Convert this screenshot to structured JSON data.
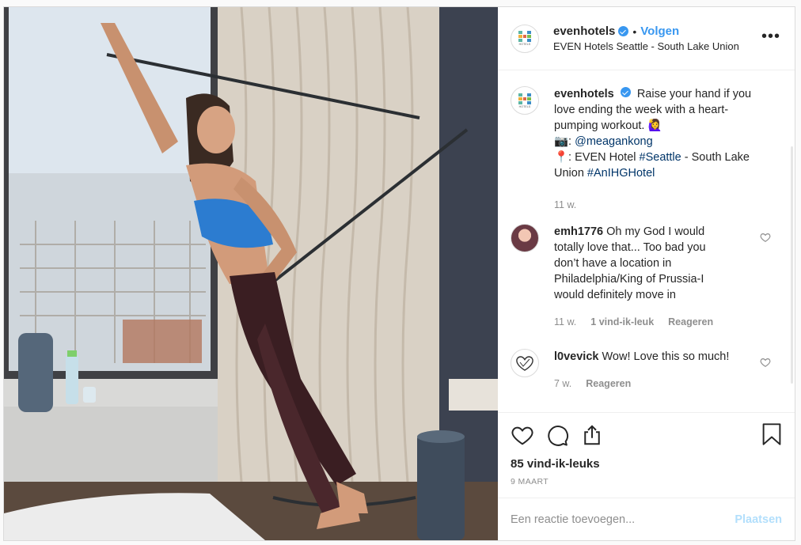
{
  "post_header": {
    "username": "evenhotels",
    "separator": "•",
    "follow_label": "Volgen",
    "location": "EVEN Hotels Seattle - South Lake Union",
    "more_label": "•••"
  },
  "logo_text": "HOTELS",
  "caption": {
    "username": "evenhotels",
    "text_1": "Raise your hand if you love ending the week with a heart-pumping workout. 🙋‍♀️",
    "camera_prefix": "📷: ",
    "mention": "@meagankong",
    "pin_prefix": "📍: EVEN Hotel ",
    "hashtag_1": "#Seattle",
    "text_2": " - South Lake Union ",
    "hashtag_2": "#AnIHGHotel",
    "time": "11 w."
  },
  "comments": [
    {
      "username": "emh1776",
      "text": "Oh my God I would totally love that... Too bad you don’t have a location in Philadelphia/King of Prussia-I would definitely move in",
      "time": "11 w.",
      "likes": "1 vind-ik-leuk",
      "reply": "Reageren"
    },
    {
      "username": "l0vevick",
      "text": "Wow! Love this so much!",
      "time": "7 w.",
      "reply": "Reageren"
    }
  ],
  "engagement": {
    "likes": "85 vind-ik-leuks",
    "date": "9 MAART"
  },
  "add_comment": {
    "placeholder": "Een reactie toevoegen...",
    "post_label": "Plaatsen"
  },
  "colors": {
    "accent": "#3897f0",
    "link": "#003569",
    "muted": "#8e8e8e",
    "post_disabled": "#b2dffc"
  },
  "icons": [
    "heart-icon",
    "comment-icon",
    "share-icon",
    "bookmark-icon",
    "verified-badge-icon",
    "more-options-icon"
  ]
}
